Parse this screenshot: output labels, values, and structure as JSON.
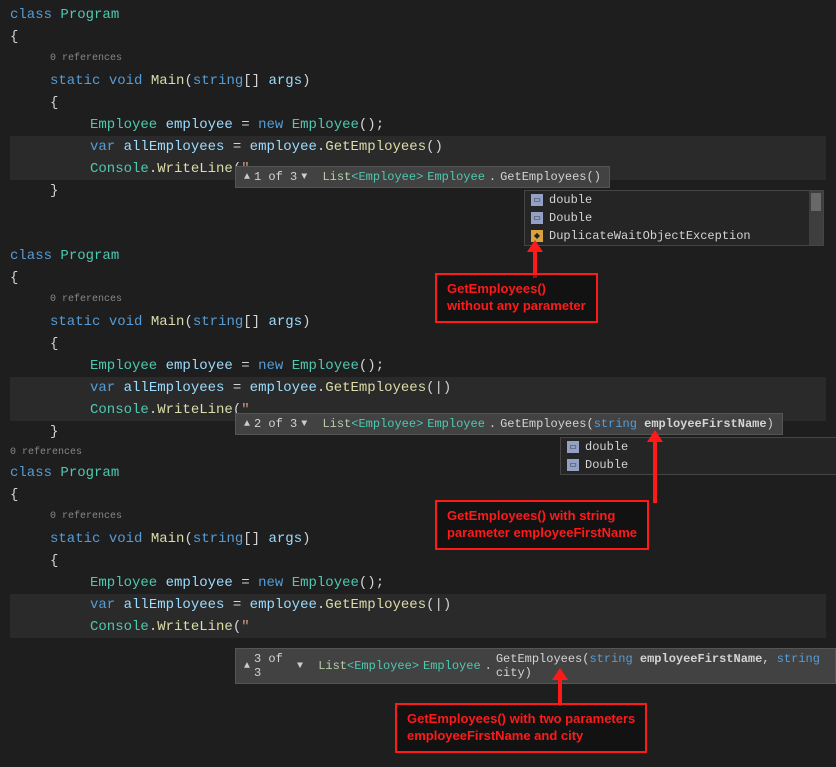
{
  "blocks": [
    {
      "codelens": "0 references",
      "class_kw": "class",
      "class_name": "Program",
      "static_kw": "static",
      "void_kw": "void",
      "main_name": "Main",
      "string_kw": "string",
      "args": "args",
      "emp_type": "Employee",
      "emp_var": "employee",
      "new_kw": "new",
      "var_kw": "var",
      "all_emp": "allEmployees",
      "get_emp": "GetEmployees",
      "console": "Console",
      "writeline": "WriteLine",
      "str_open": "\""
    }
  ],
  "tooltips": [
    {
      "nav": "1 of 3",
      "return": "List<Employee>",
      "cls": "Employee",
      "method": "GetEmployees",
      "params": "()"
    },
    {
      "nav": "2 of 3",
      "return": "List<Employee>",
      "cls": "Employee",
      "method": "GetEmployees",
      "param_type": "string",
      "param_name": "employeeFirstName"
    },
    {
      "nav": "3 of 3",
      "return": "List<Employee>",
      "cls": "Employee",
      "method": "GetEmployees",
      "param_type1": "string",
      "param_name1": "employeeFirstName",
      "param_type2": "string",
      "param_name2": "city"
    }
  ],
  "autocomplete1": {
    "items": [
      "double",
      "Double",
      "DuplicateWaitObjectException"
    ]
  },
  "autocomplete2": {
    "items": [
      "double",
      "Double"
    ]
  },
  "callouts": [
    "GetEmployees()\nwithout any parameter",
    "GetEmployees() with string\nparameter employeeFirstName",
    "GetEmployees() with two parameters\nemployeeFirstName and city"
  ],
  "extra_codelens": "0 references"
}
